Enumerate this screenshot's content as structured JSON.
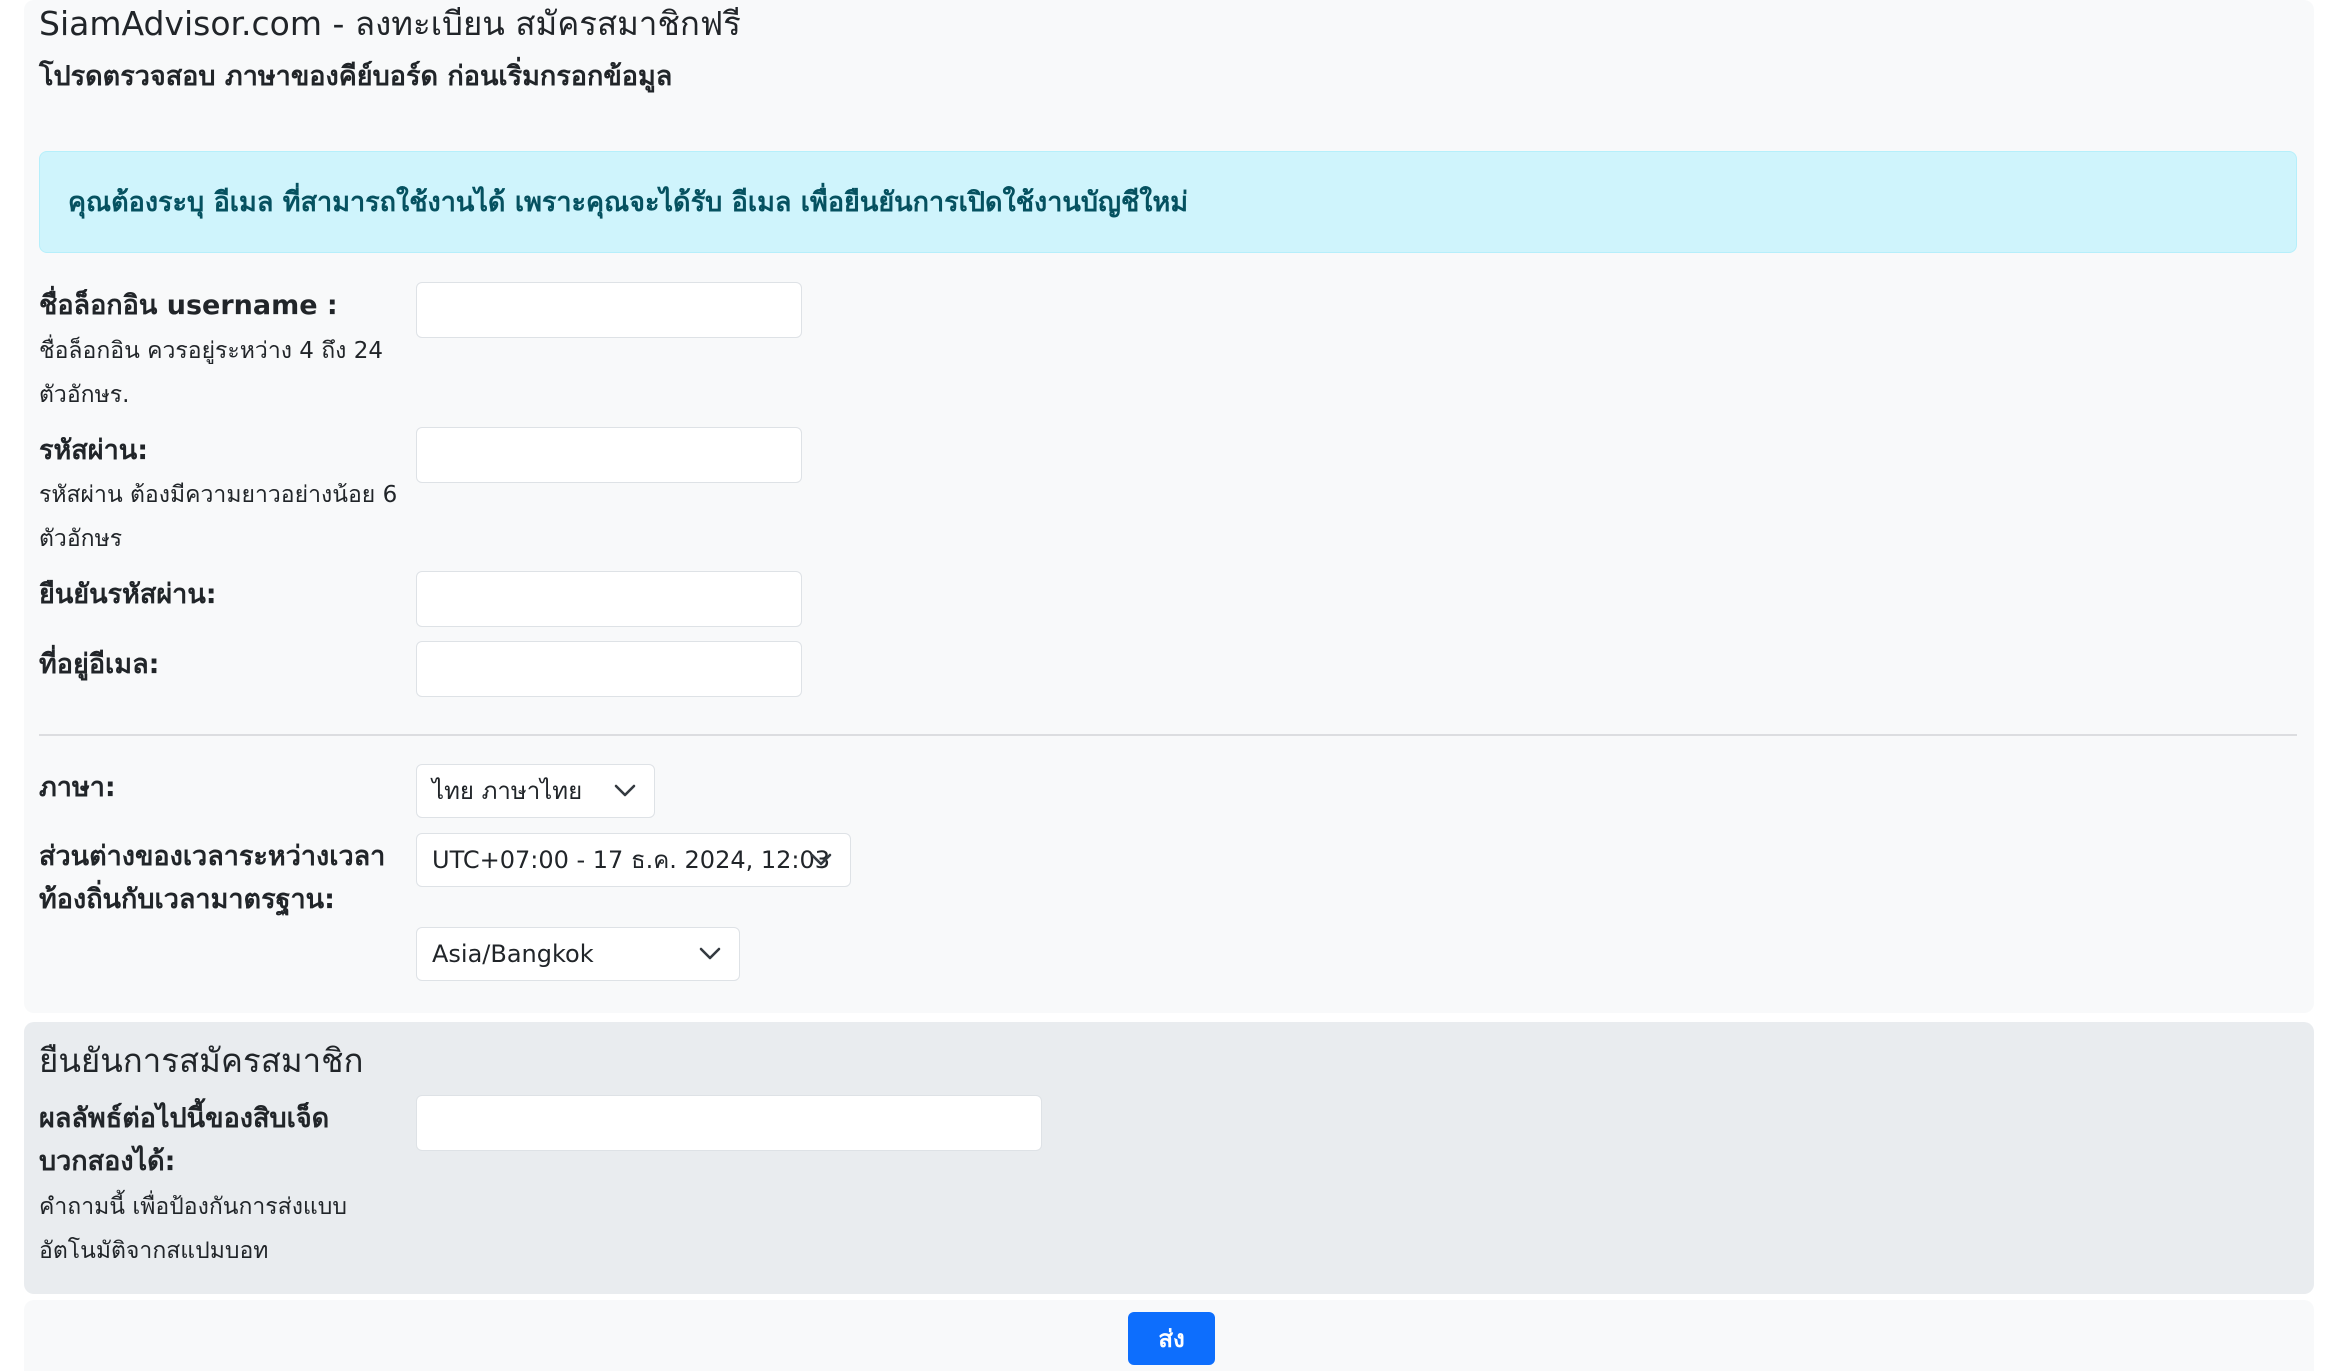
{
  "header": {
    "title": "SiamAdvisor.com - ลงทะเบียน สมัครสมาชิกฟรี",
    "subtitle": "โปรดตรวจสอบ ภาษาของคีย์บอร์ด ก่อนเริ่มกรอกข้อมูล"
  },
  "alert": {
    "text": "คุณต้องระบุ อีเมล ที่สามารถใช้งานได้ เพราะคุณจะได้รับ อีเมล เพื่อยืนยันการเปิดใช้งานบัญชีใหม่"
  },
  "form": {
    "username": {
      "label": "ชื่อล็อกอิน username :",
      "hint_line1": "ชื่อล็อกอิน ควรอยู่ระหว่าง 4 ถึง 24",
      "hint_line2": "ตัวอักษร.",
      "value": ""
    },
    "password": {
      "label": "รหัสผ่าน:",
      "hint_line1": "รหัสผ่าน ต้องมีความยาวอย่างน้อย 6",
      "hint_line2": "ตัวอักษร",
      "value": ""
    },
    "confirm_password": {
      "label": "ยืนยันรหัสผ่าน:",
      "value": ""
    },
    "email": {
      "label": "ที่อยู่อีเมล:",
      "value": ""
    },
    "language": {
      "label": "ภาษา:",
      "selected": "ไทย ภาษาไทย",
      "icon": "chevron-down-icon"
    },
    "timezone": {
      "label_line1": "ส่วนต่างของเวลาระหว่างเวลา",
      "label_line2": "ท้องถิ่นกับเวลามาตรฐาน:",
      "offset_selected": "UTC+07:00 - 17 ธ.ค. 2024, 12:03",
      "region_selected": "Asia/Bangkok",
      "icon": "chevron-down-icon"
    }
  },
  "verification": {
    "title": "ยืนยันการสมัครสมาชิก",
    "question_line1": "ผลลัพธ์ต่อไปนี้ของสิบเจ็ด",
    "question_line2": "บวกสองได้:",
    "hint_line1": "คำถามนี้ เพื่อป้องกันการส่งแบบ",
    "hint_line2": "อัตโนมัติจากสแปมบอท",
    "value": ""
  },
  "submit": {
    "label": "ส่ง",
    "color": "#0d6efd"
  },
  "colors": {
    "alert_bg": "#cff4fc",
    "alert_text": "#055160",
    "panel_bg": "#f8f9fa",
    "verify_bg": "#e9ecef"
  }
}
